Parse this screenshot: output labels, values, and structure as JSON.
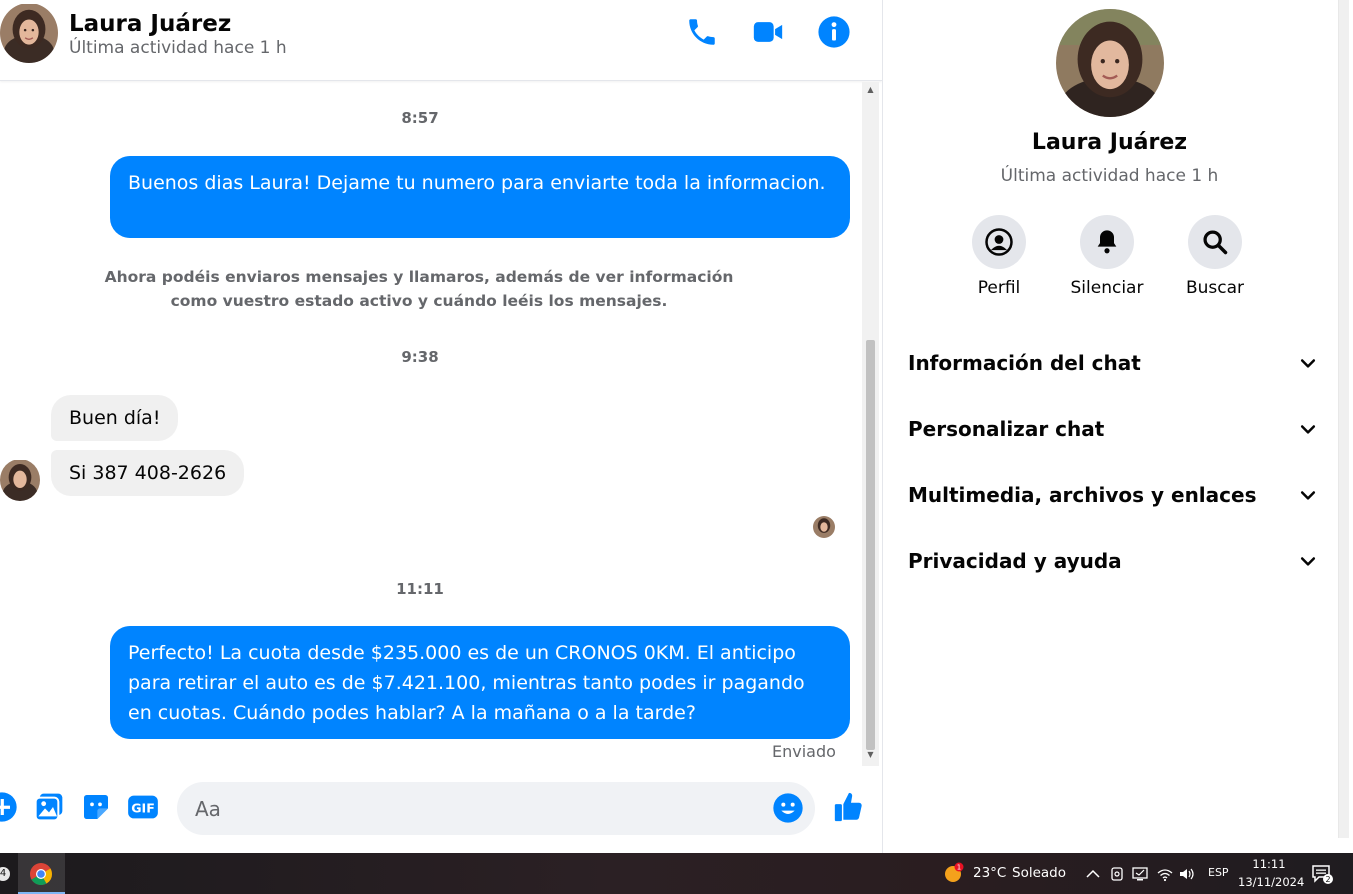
{
  "colors": {
    "accent": "#0084ff",
    "bubble_in": "#f0f0f0",
    "muted": "#65676b"
  },
  "header": {
    "name": "Laura Juárez",
    "status": "Última actividad hace 1 h",
    "icons": [
      "phone-icon",
      "video-icon",
      "info-icon"
    ]
  },
  "messages": {
    "time1": "8:57",
    "out1": "Buenos dias Laura! Dejame tu numero para enviarte toda la informacion.",
    "system_note": "Ahora podéis enviaros mensajes y llamaros, además de ver información como vuestro estado activo y cuándo leéis los mensajes.",
    "time2": "9:38",
    "in1": "Buen día!",
    "in2": "Si 387 408-2626",
    "time3": "11:11",
    "out2": "Perfecto! La cuota desde $235.000 es de un CRONOS 0KM. El anticipo para retirar el auto es de $7.421.100, mientras tanto podes ir pagando en cuotas. Cuándo podes hablar? A la mañana o a la tarde?",
    "sent_status": "Enviado"
  },
  "composer": {
    "placeholder": "Aa",
    "icons": [
      "plus-icon",
      "photo-icon",
      "sticker-icon",
      "gif-icon",
      "emoji-icon",
      "thumbs-up-icon"
    ]
  },
  "panel": {
    "name": "Laura Juárez",
    "status": "Última actividad hace 1 h",
    "actions": [
      {
        "label": "Perfil",
        "icon": "user-circle-icon"
      },
      {
        "label": "Silenciar",
        "icon": "bell-icon"
      },
      {
        "label": "Buscar",
        "icon": "search-icon"
      }
    ],
    "sections": [
      {
        "title": "Información del chat"
      },
      {
        "title": "Personalizar chat"
      },
      {
        "title": "Multimedia, archivos y enlaces"
      },
      {
        "title": "Privacidad y ayuda"
      }
    ]
  },
  "taskbar": {
    "badge": "4",
    "weather_temp": "23°C",
    "weather_cond": "Soleado",
    "weather_alert": "1",
    "lang": "ESP",
    "time": "11:11",
    "date": "13/11/2024",
    "notifications": "2"
  }
}
